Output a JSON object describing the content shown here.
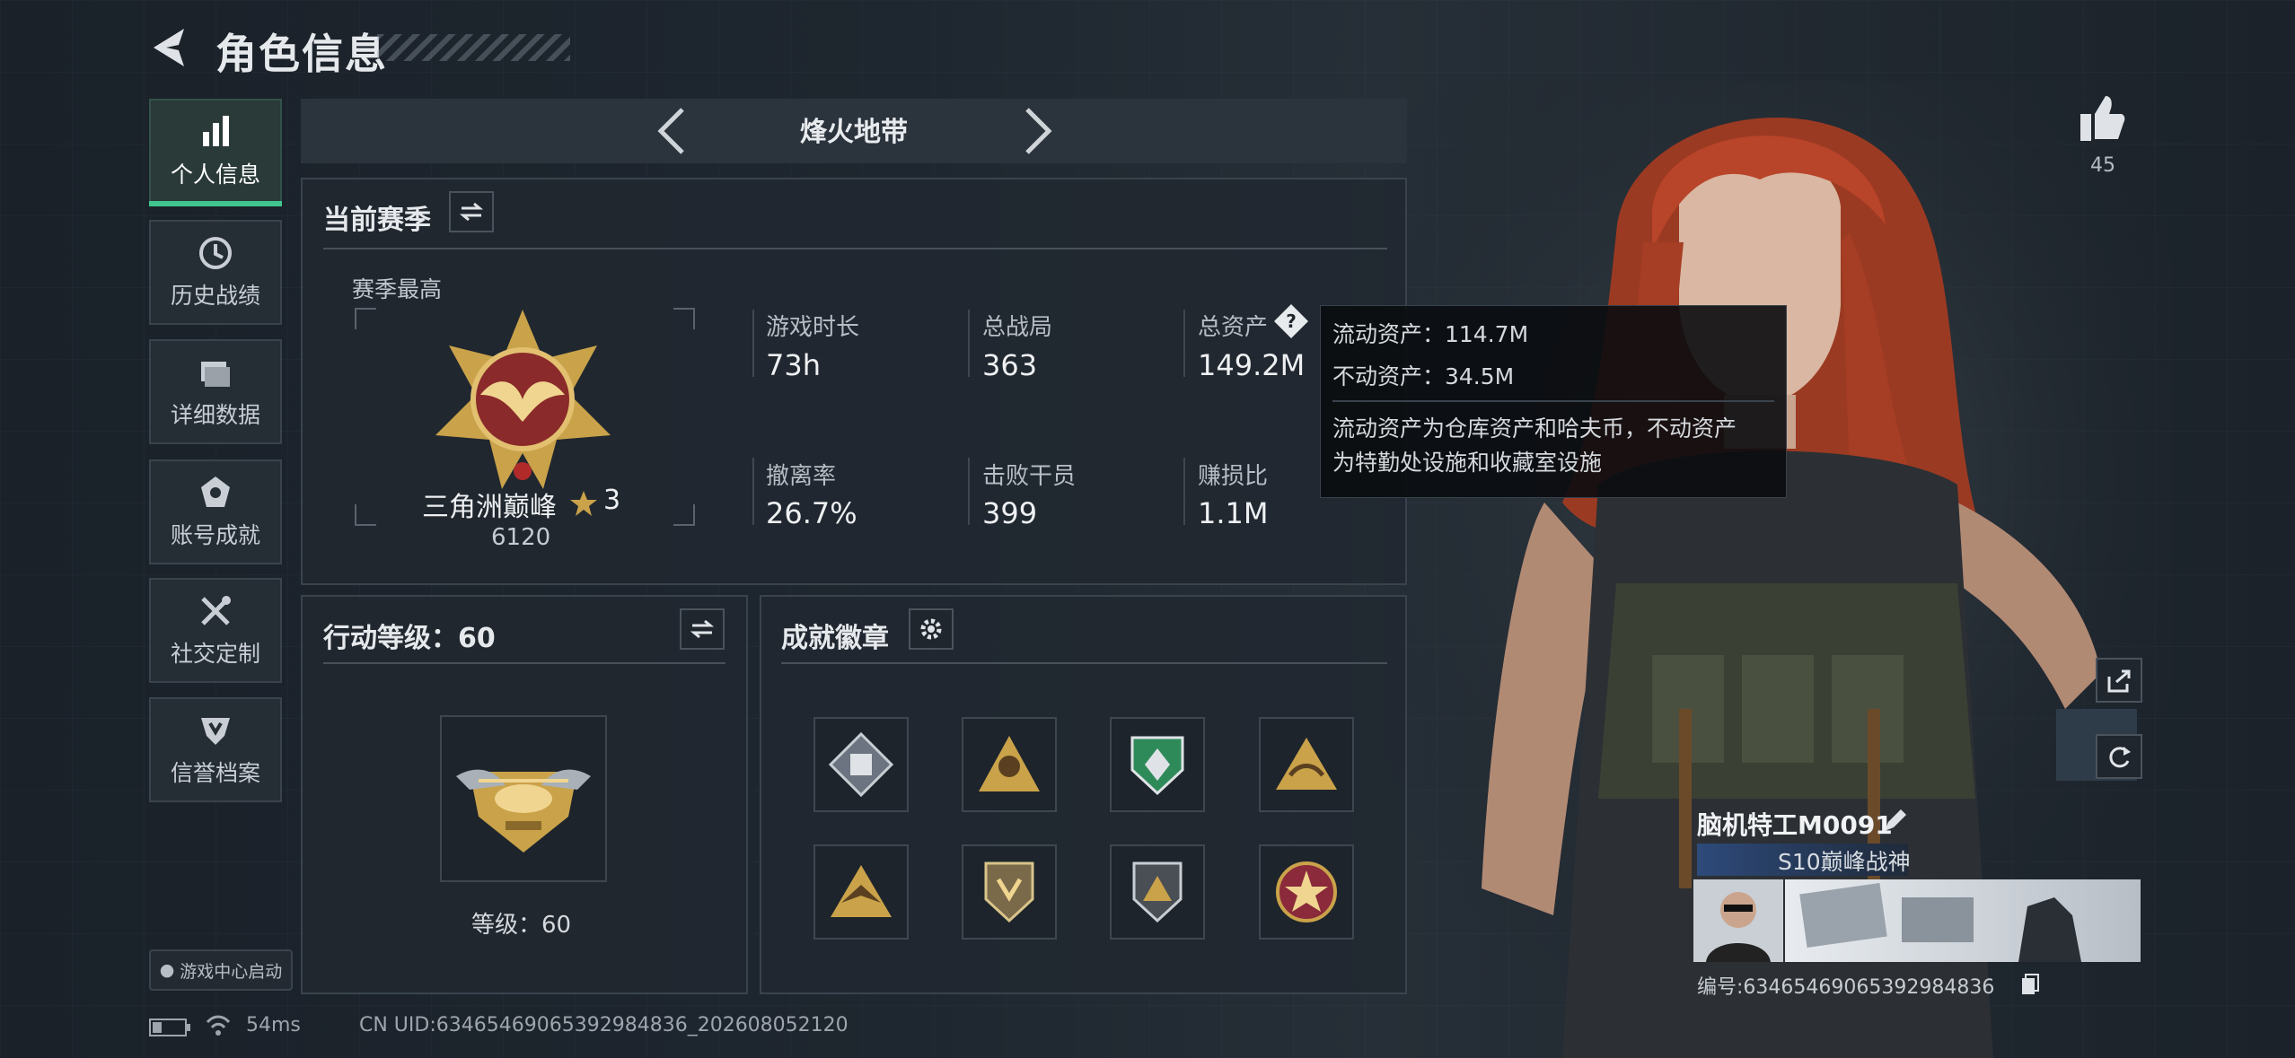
{
  "header": {
    "title": "角色信息"
  },
  "sidebar": {
    "items": [
      {
        "label": "个人信息",
        "icon": "bar-chart-icon"
      },
      {
        "label": "历史战绩",
        "icon": "clock-icon"
      },
      {
        "label": "详细数据",
        "icon": "folder-icon"
      },
      {
        "label": "账号成就",
        "icon": "achievement-icon"
      },
      {
        "label": "社交定制",
        "icon": "tools-icon"
      },
      {
        "label": "信誉档案",
        "icon": "shield-icon"
      }
    ],
    "launch_label": "游戏中心启动"
  },
  "mode": {
    "label": "烽火地带"
  },
  "season": {
    "title": "当前赛季",
    "best_label": "赛季最高",
    "rank_name": "三角洲巅峰",
    "rank_stars": "3",
    "rank_score": "6120",
    "stats": [
      {
        "label": "游戏时长",
        "value": "73h"
      },
      {
        "label": "总战局",
        "value": "363"
      },
      {
        "label": "总资产",
        "value": "149.2M"
      },
      {
        "label": "撤离率",
        "value": "26.7%"
      },
      {
        "label": "击败干员",
        "value": "399"
      },
      {
        "label": "赚损比",
        "value": "1.1M"
      }
    ]
  },
  "tooltip": {
    "liquid": "流动资产：114.7M",
    "fixed": "不动资产：34.5M",
    "desc_1": "流动资产为仓库资产和哈夫币，不动资产",
    "desc_2": "为特勤处设施和收藏室设施"
  },
  "action_level": {
    "title": "行动等级：60",
    "level_text": "等级：60"
  },
  "achievements": {
    "title": "成就徽章",
    "badges": [
      "badge-cube-icon",
      "badge-soldier-icon",
      "badge-green-shield-icon",
      "badge-triangle-icon",
      "badge-eagle-icon",
      "badge-shield-icon",
      "badge-delta-icon",
      "badge-star-seal-icon"
    ]
  },
  "likes": {
    "count": "45"
  },
  "player": {
    "name": "脑机特工M0091",
    "title": "S10巅峰战神",
    "id_text": "编号:6346546906539298483​6"
  },
  "status": {
    "ping": "54ms",
    "uid": "CN UID:6346546906539298483​6_202608052120"
  },
  "colors": {
    "accent_green": "#3fc58d",
    "hair_red": "#b8442a",
    "gold": "#c9a24a"
  }
}
